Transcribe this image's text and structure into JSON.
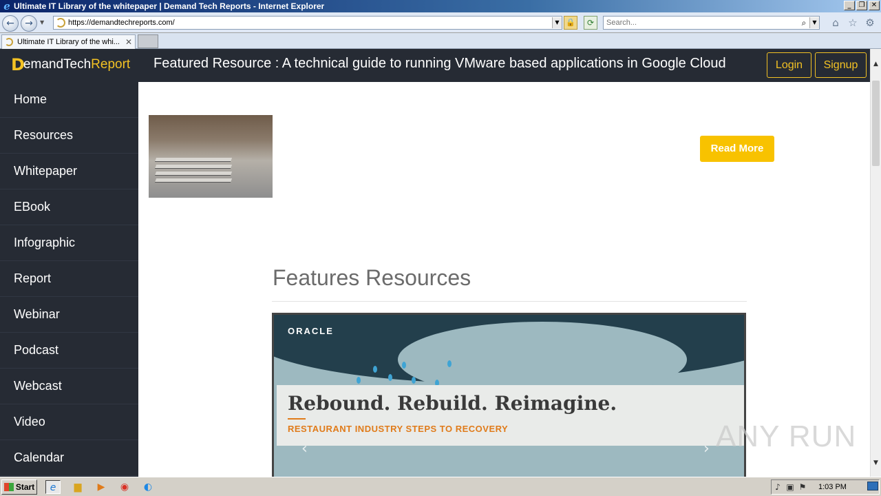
{
  "window": {
    "title": "Ultimate IT Library of the whitepaper | Demand Tech Reports - Internet Explorer",
    "controls": [
      "_",
      "❐",
      "✕"
    ]
  },
  "addressbar": {
    "url": "https://demandtechreports.com/",
    "search_placeholder": "Search..."
  },
  "tabs": [
    {
      "label": "Ultimate IT Library of the whi...",
      "close": "✕"
    }
  ],
  "header": {
    "logo_mark": "D",
    "logo_demand": "emandTech",
    "logo_report": "Report",
    "featured_text": "Featured Resource : A technical guide to running VMware based applications in Google Cloud",
    "login_label": "Login",
    "signup_label": "Signup"
  },
  "sidebar": {
    "items": [
      {
        "label": "Home"
      },
      {
        "label": "Resources"
      },
      {
        "label": "Whitepaper"
      },
      {
        "label": "EBook"
      },
      {
        "label": "Infographic"
      },
      {
        "label": "Report"
      },
      {
        "label": "Webinar"
      },
      {
        "label": "Podcast"
      },
      {
        "label": "Webcast"
      },
      {
        "label": "Video"
      },
      {
        "label": "Calendar"
      }
    ]
  },
  "main": {
    "read_more_label": "Read More",
    "section_title": "Features Resources",
    "banner": {
      "brand": "ORACLE",
      "headline": "Rebound. Rebuild. Reimagine.",
      "subline": "RESTAURANT INDUSTRY STEPS TO RECOVERY",
      "prev_arrow": "‹",
      "next_arrow": "›"
    }
  },
  "watermark": "ANY RUN",
  "taskbar": {
    "start_label": "Start",
    "clock": "1:03 PM"
  },
  "colors": {
    "accent": "#f3c224",
    "dark_nav": "#262b34",
    "read_more": "#f8c200"
  }
}
